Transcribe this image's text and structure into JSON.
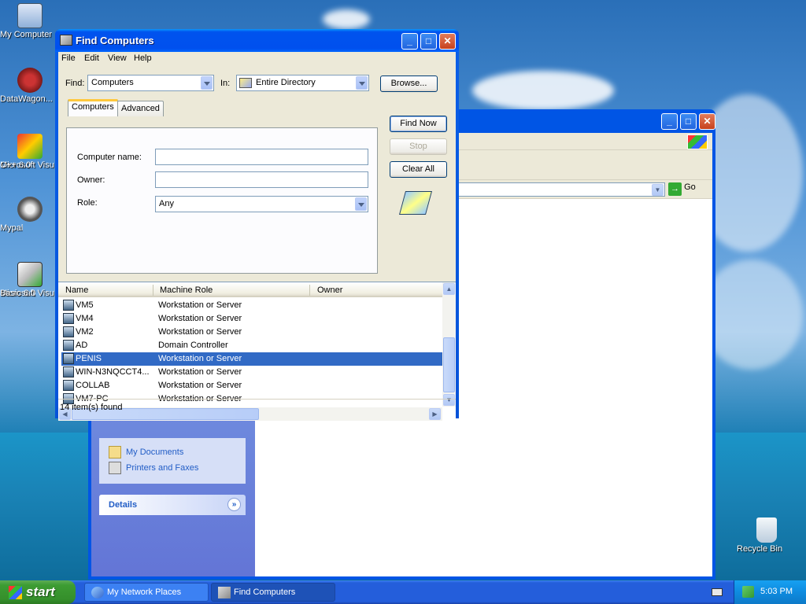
{
  "desktop": {
    "icons": [
      {
        "label": "My Computer"
      },
      {
        "label": "DataWagon..."
      },
      {
        "label": "Microsoft Visual C++ 6.0",
        "line1": "Microsoft Visu",
        "line2": "C++ 6.0"
      },
      {
        "label": "Mypal"
      },
      {
        "label": "Microsoft Visual Basic 6.0",
        "line1": "Microsoft Visu",
        "line2": "Basic 6.0"
      },
      {
        "label": "Recycle Bin"
      }
    ]
  },
  "explorer": {
    "go_label": "Go",
    "tasks": [
      "My Documents",
      "Printers and Faxes"
    ],
    "details_label": "Details"
  },
  "find": {
    "title": "Find Computers",
    "menu": [
      "File",
      "Edit",
      "View",
      "Help"
    ],
    "find_label": "Find:",
    "find_value": "Computers",
    "in_label": "In:",
    "in_value": "Entire Directory",
    "browse_label": "Browse...",
    "tabs": [
      "Computers",
      "Advanced"
    ],
    "computer_name_label": "Computer name:",
    "computer_name_value": "",
    "owner_label": "Owner:",
    "owner_value": "",
    "role_label": "Role:",
    "role_value": "Any",
    "find_now_label": "Find Now",
    "stop_label": "Stop",
    "clear_all_label": "Clear All",
    "columns": [
      "Name",
      "Machine Role",
      "Owner"
    ],
    "rows": [
      {
        "name": "VM5",
        "role": "Workstation or Server",
        "owner": ""
      },
      {
        "name": "VM4",
        "role": "Workstation or Server",
        "owner": ""
      },
      {
        "name": "VM2",
        "role": "Workstation or Server",
        "owner": ""
      },
      {
        "name": "AD",
        "role": "Domain Controller",
        "owner": ""
      },
      {
        "name": "PENIS",
        "role": "Workstation or Server",
        "owner": "",
        "selected": true
      },
      {
        "name": "WIN-N3NQCCT4...",
        "role": "Workstation or Server",
        "owner": ""
      },
      {
        "name": "COLLAB",
        "role": "Workstation or Server",
        "owner": ""
      },
      {
        "name": "VM7-PC",
        "role": "Workstation or Server",
        "owner": ""
      }
    ],
    "status": "14 item(s) found"
  },
  "taskbar": {
    "start_label": "start",
    "buttons": [
      "My Network Places",
      "Find Computers"
    ],
    "active_index": 1,
    "clock": "5:03 PM"
  },
  "colors": {
    "xp_blue": "#0055e5",
    "selection": "#316ac5",
    "start_green": "#3d9c33"
  }
}
